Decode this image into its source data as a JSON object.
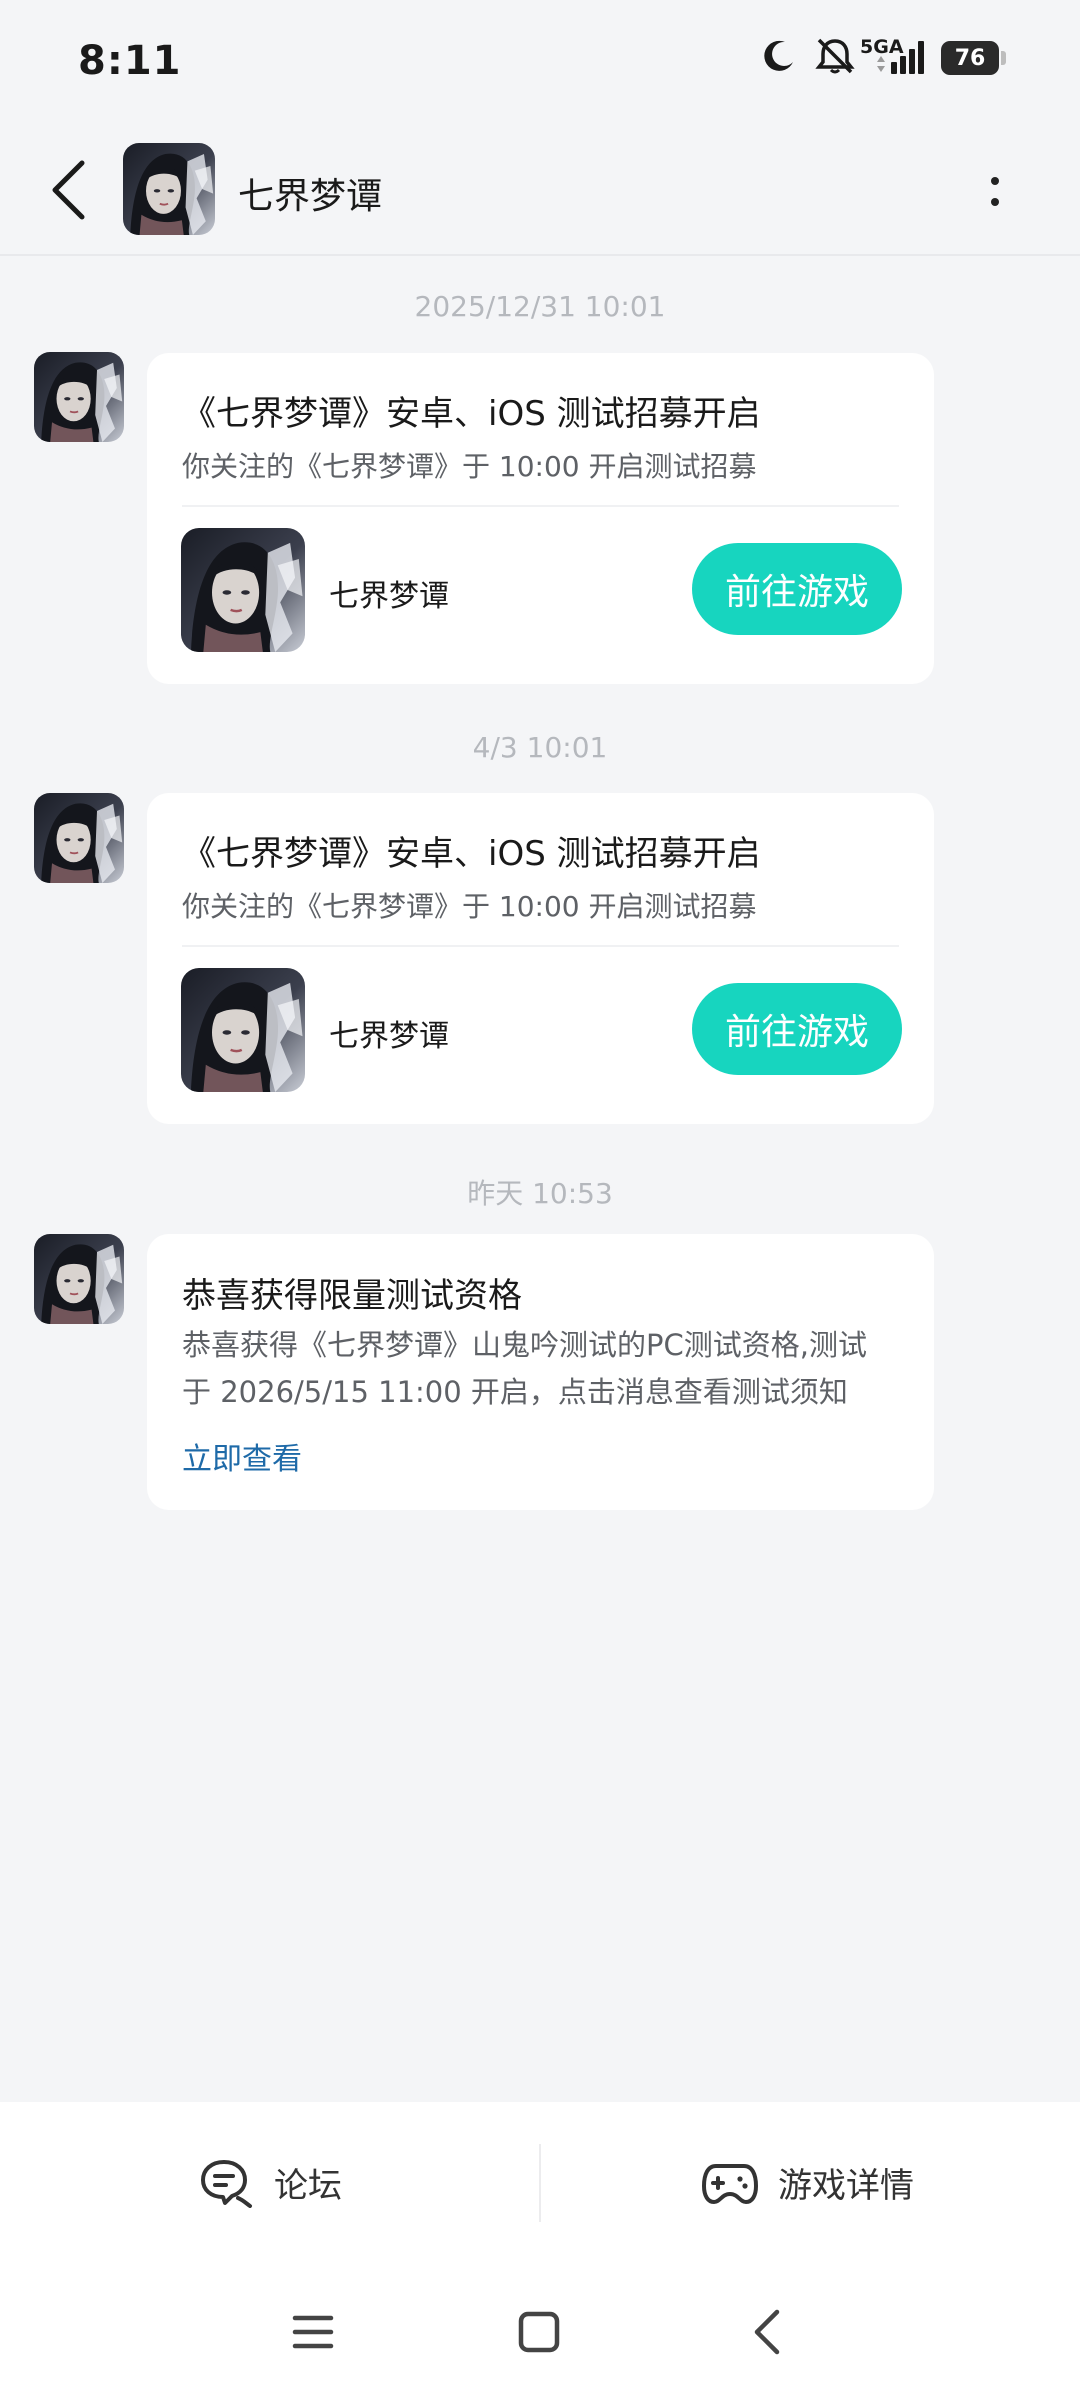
{
  "status_bar": {
    "time": "8:11",
    "network": "5GA",
    "battery": "76",
    "icons": [
      "moon-icon",
      "bell-muted-icon",
      "signal-icon",
      "battery-icon"
    ]
  },
  "header": {
    "title": "七界梦谭",
    "icons": [
      "back-arrow-icon",
      "more-vertical-icon"
    ]
  },
  "messages": [
    {
      "timestamp": "2025/12/31  10:01",
      "title": "《七界梦谭》安卓、iOS 测试招募开启",
      "subtitle": "你关注的《七界梦谭》于 10:00 开启测试招募",
      "game_name": "七界梦谭",
      "button_label": "前往游戏"
    },
    {
      "timestamp": "4/3  10:01",
      "title": "《七界梦谭》安卓、iOS 测试招募开启",
      "subtitle": "你关注的《七界梦谭》于 10:00 开启测试招募",
      "game_name": "七界梦谭",
      "button_label": "前往游戏"
    },
    {
      "timestamp": "昨天  10:53",
      "title": "恭喜获得限量测试资格",
      "body_line1": "恭喜获得《七界梦谭》山鬼吟测试的PC测试资格,测试",
      "body_line2": "于 2026/5/15 11:00 开启，点击消息查看测试须知",
      "link_label": "立即查看"
    }
  ],
  "bottom_bar": {
    "forum_label": "论坛",
    "game_detail_label": "游戏详情"
  },
  "colors": {
    "accent": "#17d5bf",
    "link": "#1e6aa8",
    "background": "#f4f5f7"
  }
}
